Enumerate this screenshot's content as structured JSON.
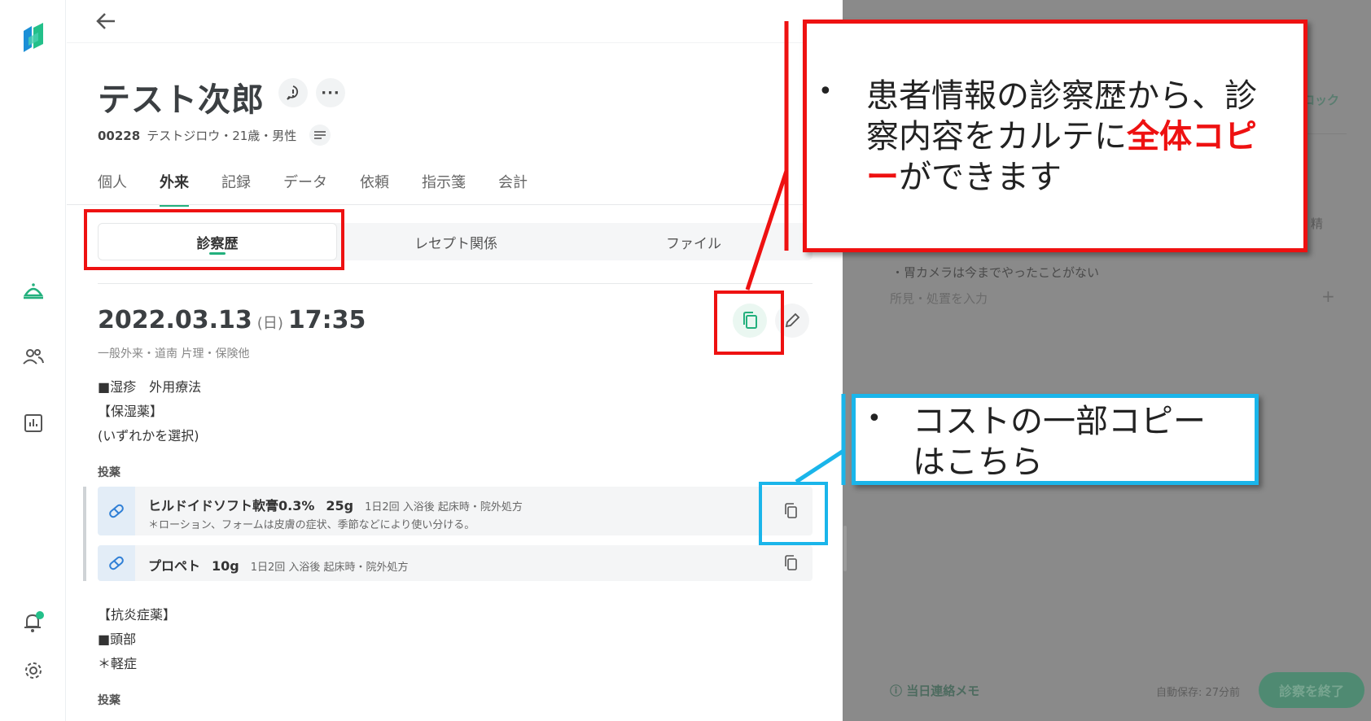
{
  "patient": {
    "name": "テスト次郎",
    "id": "00228",
    "details": "テストジロウ・21歳・男性"
  },
  "tabs": [
    {
      "label": "個人"
    },
    {
      "label": "外来"
    },
    {
      "label": "記録"
    },
    {
      "label": "データ"
    },
    {
      "label": "依頼"
    },
    {
      "label": "指示箋"
    },
    {
      "label": "会計"
    }
  ],
  "subtabs": [
    {
      "label": "診察歴"
    },
    {
      "label": "レセプト関係"
    },
    {
      "label": "ファイル"
    }
  ],
  "visit": {
    "date": "2022.03.13",
    "dow": "(日)",
    "time": "17:35",
    "sub": "一般外来・道南 片理・保険他",
    "note_lines": [
      "■湿疹　外用療法",
      "【保湿薬】",
      "(いずれかを選択)"
    ],
    "drug_section_label": "投薬",
    "meds": [
      {
        "name": "ヒルドイドソフト軟膏0.3%",
        "qty": "25g",
        "instruction": "1日2回 入浴後 起床時・院外処方",
        "note": "＊ローション、フォームは皮膚の症状、季節などにより使い分ける。"
      },
      {
        "name": "プロペト",
        "qty": "10g",
        "instruction": "1日2回 入浴後 起床時・院外処方",
        "note": ""
      }
    ],
    "note_lines_2": [
      "【抗炎症薬】",
      "■頭部",
      "＊軽症"
    ],
    "drug_section_label_2": "投薬"
  },
  "right_panel": {
    "partial_top": "ロック",
    "partial_right": "、精",
    "text_line": "・胃カメラは今までやったことがない",
    "placeholder": "所見・処置を入力",
    "plus": "+",
    "memo": "当日連絡メモ",
    "autosave": "自動保存: 27分前",
    "finish_button": "診察を終了"
  },
  "annotations": {
    "red_callout": {
      "bullet": "•",
      "line1": "患者情報の診察歴から、診",
      "line2_plain": "察内容をカルテに",
      "line2_em": "全体コピ",
      "line3_em": "ー",
      "line3_plain": "ができます"
    },
    "blue_callout": {
      "bullet": "•",
      "line1": "コストの一部コピー",
      "line2": "はこちら"
    }
  },
  "colors": {
    "accent": "#23b07d",
    "annotation_red": "#ee1111",
    "annotation_blue": "#1ab5ea",
    "overlay_gray": "#8a8a8a"
  },
  "icons": {
    "logo": "app-logo-icon",
    "back": "arrow-left-icon",
    "reception": "bell-tray-icon",
    "patients": "users-icon",
    "reports": "chart-icon",
    "notifications": "notification-bell-icon",
    "settings": "gear-icon"
  }
}
